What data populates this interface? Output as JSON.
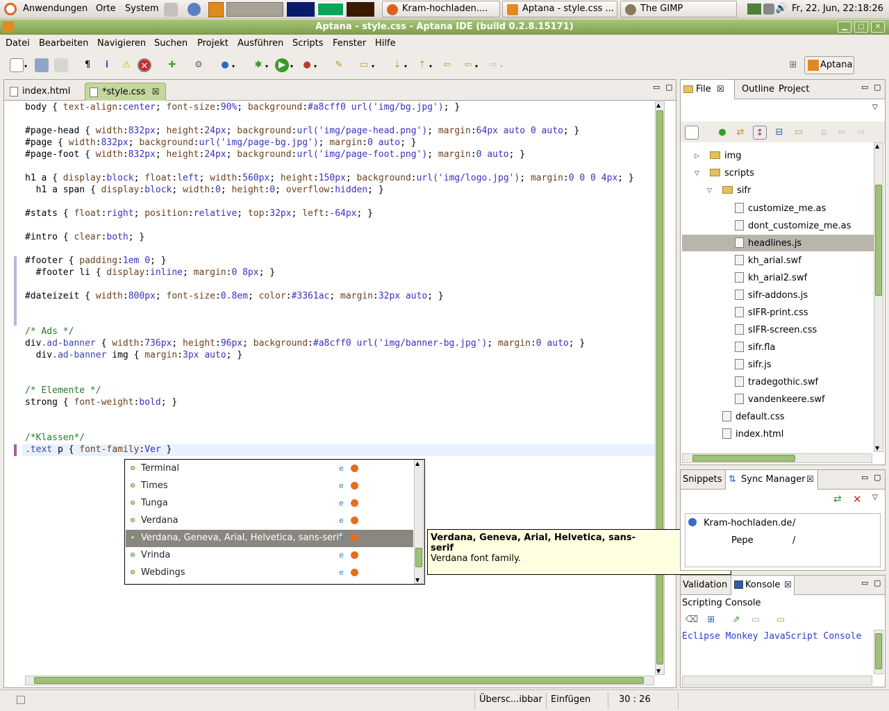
{
  "panel": {
    "menu_apps": "Anwendungen",
    "menu_places": "Orte",
    "menu_system": "System",
    "tasks": [
      "Kram-hochladen....",
      "Aptana - style.css ...",
      "The GIMP"
    ],
    "clock": "Fr, 22. Jun, 22:18:26"
  },
  "window": {
    "title": "Aptana - style.css - Aptana IDE (build 0.2.8.15171)"
  },
  "menubar": [
    "Datei",
    "Bearbeiten",
    "Navigieren",
    "Suchen",
    "Projekt",
    "Ausführen",
    "Scripts",
    "Fenster",
    "Hilfe"
  ],
  "perspective": "Aptana",
  "editor": {
    "tabs": [
      "index.html",
      "*style.css"
    ],
    "lines": [
      "body { text-align:center; font-size:90%; background:#a8cff0 url('img/bg.jpg'); }",
      "",
      "#page-head { width:832px; height:24px; background:url('img/page-head.png'); margin:64px auto 0 auto; }",
      "#page { width:832px; background:url('img/page-bg.jpg'); margin:0 auto; }",
      "#page-foot { width:832px; height:24px; background:url('img/page-foot.png'); margin:0 auto; }",
      "",
      "h1 a { display:block; float:left; width:560px; height:150px; background:url('img/logo.jpg'); margin:0 0 0 4px; }",
      "  h1 a span { display:block; width:0; height:0; overflow:hidden; }",
      "",
      "#stats { float:right; position:relative; top:32px; left:-64px; }",
      "",
      "#intro { clear:both; }",
      "",
      "#footer { padding:1em 0; }",
      "  #footer li { display:inline; margin:0 8px; }",
      "",
      "#dateizeit { width:800px; font-size:0.8em; color:#3361ac; margin:32px auto; }",
      "",
      "",
      "/* Ads */",
      "div.ad-banner { width:736px; height:96px; background:#a8cff0 url('img/banner-bg.jpg'); margin:0 auto; }",
      "  div.ad-banner img { margin:3px auto; }",
      "",
      "",
      "/* Elemente */",
      "strong { font-weight:bold; }",
      "",
      "",
      "/*Klassen*/",
      ".text p { font-family:Ver }"
    ]
  },
  "autocomplete": {
    "items": [
      "Terminal",
      "Times",
      "Tunga",
      "Verdana",
      "Verdana, Geneva, Arial, Helvetica, sans-serif",
      "Vrinda",
      "Webdings"
    ],
    "selected_index": 4
  },
  "tooltip": {
    "title": "Verdana, Geneva, Arial, Helvetica, sans-serif",
    "desc": "Verdana font family."
  },
  "file_view": {
    "tabs": [
      "File",
      "Outline",
      "Project"
    ],
    "tree": [
      {
        "label": "img",
        "type": "folder",
        "depth": 1,
        "twisty": "▷"
      },
      {
        "label": "scripts",
        "type": "folder",
        "depth": 1,
        "twisty": "▽"
      },
      {
        "label": "sifr",
        "type": "folder",
        "depth": 2,
        "twisty": "▽"
      },
      {
        "label": "customize_me.as",
        "type": "file",
        "depth": 3
      },
      {
        "label": "dont_customize_me.as",
        "type": "file",
        "depth": 3
      },
      {
        "label": "headlines.js",
        "type": "file",
        "depth": 3,
        "selected": true
      },
      {
        "label": "kh_arial.swf",
        "type": "file",
        "depth": 3
      },
      {
        "label": "kh_arial2.swf",
        "type": "file",
        "depth": 3
      },
      {
        "label": "sifr-addons.js",
        "type": "file",
        "depth": 3
      },
      {
        "label": "sIFR-print.css",
        "type": "file",
        "depth": 3
      },
      {
        "label": "sIFR-screen.css",
        "type": "file",
        "depth": 3
      },
      {
        "label": "sifr.fla",
        "type": "file",
        "depth": 3
      },
      {
        "label": "sifr.js",
        "type": "file",
        "depth": 3
      },
      {
        "label": "tradegothic.swf",
        "type": "file",
        "depth": 3
      },
      {
        "label": "vandenkeere.swf",
        "type": "file",
        "depth": 3
      },
      {
        "label": "default.css",
        "type": "file",
        "depth": 2
      },
      {
        "label": "index.html",
        "type": "file",
        "depth": 2
      }
    ]
  },
  "sync": {
    "tabs": [
      "Snippets",
      "Sync Manager"
    ],
    "rows": [
      {
        "name": "Kram-hochladen.de",
        "path": "/"
      },
      {
        "name": "Pepe",
        "path": "/"
      }
    ]
  },
  "console": {
    "tabs": [
      "Validation",
      "Konsole"
    ],
    "label": "Scripting Console",
    "text": "Eclipse Monkey JavaScript Console"
  },
  "status": {
    "mode": "Übersc...ibbar",
    "insert": "Einfügen",
    "position": "30 : 26"
  },
  "colors": {
    "accent": "#7d9e4c",
    "selection": "#8b8780",
    "tooltip_bg": "#ffffe1"
  }
}
